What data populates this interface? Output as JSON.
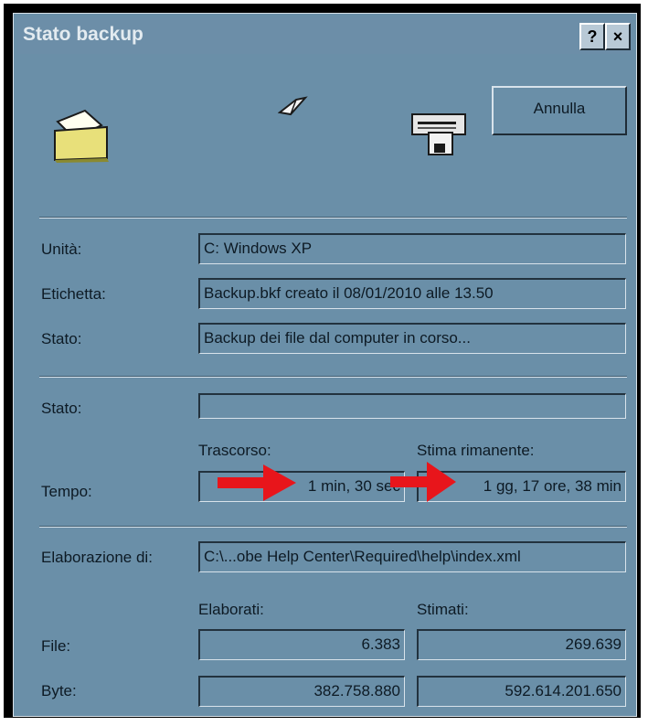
{
  "window": {
    "title": "Stato backup",
    "help_button": "?",
    "close_button": "×"
  },
  "toolbar": {
    "cancel_label": "Annulla"
  },
  "icons": {
    "source": "folder-icon",
    "transfer": "flying-paper-icon",
    "destination": "backup-device-icon",
    "arrows": "red-arrow-icon"
  },
  "info": {
    "drive_label": "Unità:",
    "drive_value": "C: Windows XP",
    "tag_label": "Etichetta:",
    "tag_value": "Backup.bkf creato il 08/01/2010 alle 13.50",
    "status_label": "Stato:",
    "status_value": "Backup dei file dal computer in corso..."
  },
  "progress": {
    "status_label": "Stato:",
    "status_value": "",
    "elapsed_header": "Trascorso:",
    "remaining_header": "Stima rimanente:",
    "time_label": "Tempo:",
    "elapsed_value": "1 min, 30 sec",
    "remaining_value": "1 gg, 17 ore, 38 min"
  },
  "processing": {
    "label": "Elaborazione di:",
    "value": "C:\\...obe Help Center\\Required\\help\\index.xml"
  },
  "stats": {
    "processed_header": "Elaborati:",
    "estimated_header": "Stimati:",
    "files_label": "File:",
    "files_processed": "6.383",
    "files_estimated": "269.639",
    "bytes_label": "Byte:",
    "bytes_processed": "382.758.880",
    "bytes_estimated": "592.614.201.650"
  },
  "colors": {
    "window_bg": "#6a8fa8",
    "title_text": "#e3ebf0",
    "arrow": "#e8151b"
  }
}
